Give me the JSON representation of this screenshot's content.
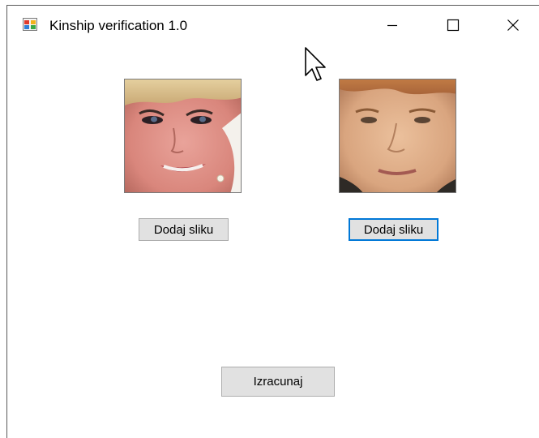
{
  "window": {
    "title": "Kinship verification 1.0",
    "icons": {
      "app": "app-icon",
      "minimize": "minimize-icon",
      "maximize": "maximize-icon",
      "close": "close-icon",
      "cursor": "mouse-cursor-icon"
    }
  },
  "photos": {
    "left": "face-photo-woman",
    "right": "face-photo-young-man"
  },
  "buttons": {
    "add_left_label": "Dodaj sliku",
    "add_right_label": "Dodaj sliku",
    "calculate_label": "Izracunaj"
  },
  "colors": {
    "focus_border": "#0078d7",
    "button_bg": "#e1e1e1"
  }
}
